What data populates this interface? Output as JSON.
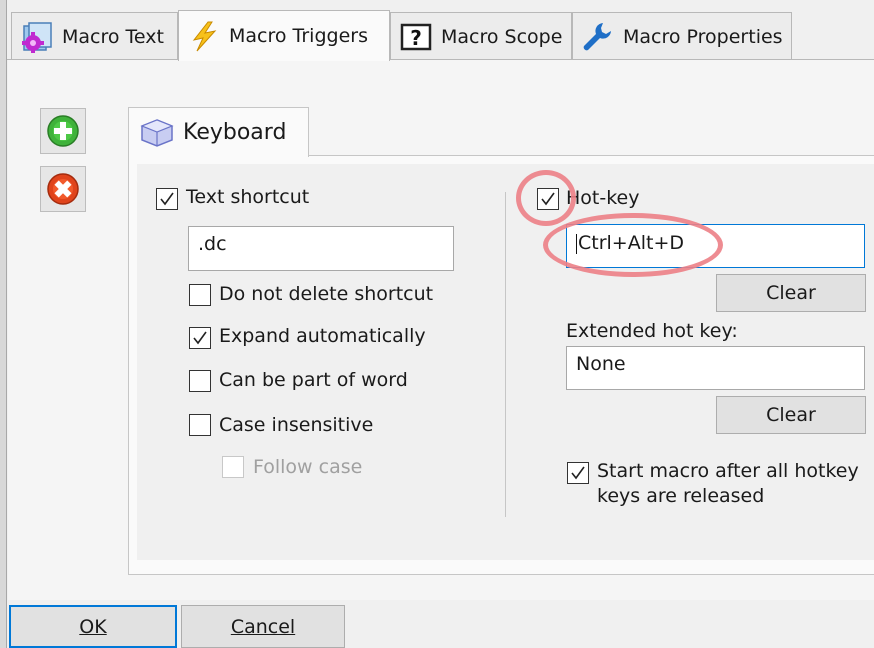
{
  "tabs": [
    {
      "label": "Macro Text",
      "icon": "gear-magenta-icon"
    },
    {
      "label": "Macro Triggers",
      "icon": "lightning-icon",
      "active": true
    },
    {
      "label": "Macro Scope",
      "icon": "question-icon"
    },
    {
      "label": "Macro Properties",
      "icon": "wrench-icon"
    }
  ],
  "side_buttons": {
    "add": "add-trigger",
    "remove": "remove-trigger"
  },
  "keyboard_tab": {
    "label": "Keyboard"
  },
  "left": {
    "text_shortcut": {
      "label": "Text shortcut",
      "checked": true
    },
    "shortcut_value": ".dc",
    "options": [
      {
        "label": "Do not delete shortcut",
        "checked": false
      },
      {
        "label": "Expand automatically",
        "checked": true
      },
      {
        "label": "Can be part of word",
        "checked": false
      },
      {
        "label": "Case insensitive",
        "checked": false
      }
    ],
    "follow_case": {
      "label": "Follow case",
      "checked": false,
      "disabled": true
    }
  },
  "right": {
    "hotkey": {
      "label": "Hot-key",
      "checked": true,
      "value": "Ctrl+Alt+D"
    },
    "clear1": "Clear",
    "extended_label": "Extended hot key:",
    "extended_value": "None",
    "clear2": "Clear",
    "start_after": {
      "line1": "Start macro after all hotkey",
      "line2": "keys are released",
      "checked": true
    }
  },
  "footer": {
    "ok": "OK",
    "cancel": "Cancel"
  },
  "colors": {
    "highlight": "#ec7f86",
    "focus": "#0078d7"
  }
}
